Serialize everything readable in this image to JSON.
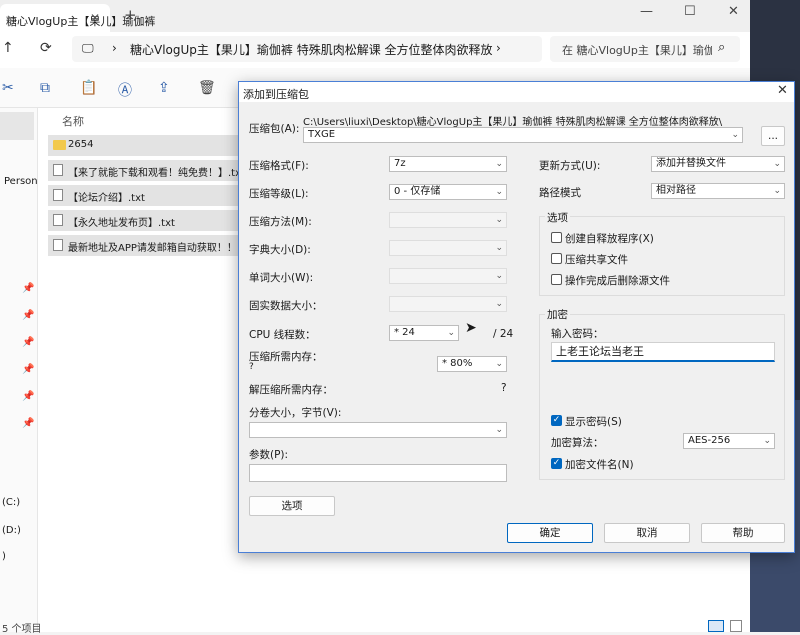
{
  "explorer": {
    "tab_title": "糖心VlogUp主【果儿】瑜伽裤",
    "tab_close": "✕",
    "tab_add": "+",
    "address": "糖心VlogUp主【果儿】瑜伽裤 特殊肌肉松解课 全方位整体肉欲释放",
    "search": "在 糖心VlogUp主【果儿】瑜伽裤 特殊肌肉松解课 全方位整体肉欲释放 中搜索",
    "column_name": "名称",
    "sidebar_person": "Person",
    "drive_c": "(C:)",
    "drive_d": "(D:)",
    "drive_e": ")",
    "status": "5 个项目",
    "files": [
      {
        "name": "2654",
        "kind": "folder"
      },
      {
        "name": "【来了就能下载和观看！纯免费！】.txt",
        "kind": "txt"
      },
      {
        "name": "【论坛介绍】.txt",
        "kind": "txt"
      },
      {
        "name": "【永久地址发布页】.txt",
        "kind": "txt"
      },
      {
        "name": "最新地址及APP请发邮箱自动获取！！",
        "kind": "txt"
      }
    ]
  },
  "dialog": {
    "title": "添加到压缩包",
    "archive_label": "压缩包(A):",
    "archive_path": "C:\\Users\\liuxi\\Desktop\\糖心VlogUp主【果儿】瑜伽裤 特殊肌肉松解课 全方位整体肉欲释放\\",
    "archive_name": "TXGE",
    "browse_label": "...",
    "format_label": "压缩格式(F):",
    "format_value": "7z",
    "level_label": "压缩等级(L):",
    "level_value": "0 - 仅存储",
    "method_label": "压缩方法(M):",
    "dict_label": "字典大小(D):",
    "word_label": "单词大小(W):",
    "solid_label": "固实数据大小：",
    "cpu_label": "CPU 线程数：",
    "cpu_value": "* 24",
    "cpu_total": "/ 24",
    "mem_label": "压缩所需内存：",
    "mem_q": "?",
    "mem_value": "* 80%",
    "decomp_label": "解压缩所需内存：",
    "decomp_q": "?",
    "split_label": "分卷大小，字节(V):",
    "params_label": "参数(P):",
    "options_button": "选项",
    "update_label": "更新方式(U):",
    "update_value": "添加并替换文件",
    "path_label": "路径模式",
    "path_value": "相对路径",
    "options_group": "选项",
    "opt_sfx": "创建自释放程序(X)",
    "opt_shared": "压缩共享文件",
    "opt_delete": "操作完成后删除源文件",
    "enc_group": "加密",
    "pw_label": "输入密码：",
    "pw_value": "上老王论坛当老王",
    "show_pw": "显示密码(S)",
    "enc_method_label": "加密算法：",
    "enc_method_value": "AES-256",
    "enc_names": "加密文件名(N)",
    "ok": "确定",
    "cancel": "取消",
    "help": "帮助"
  }
}
